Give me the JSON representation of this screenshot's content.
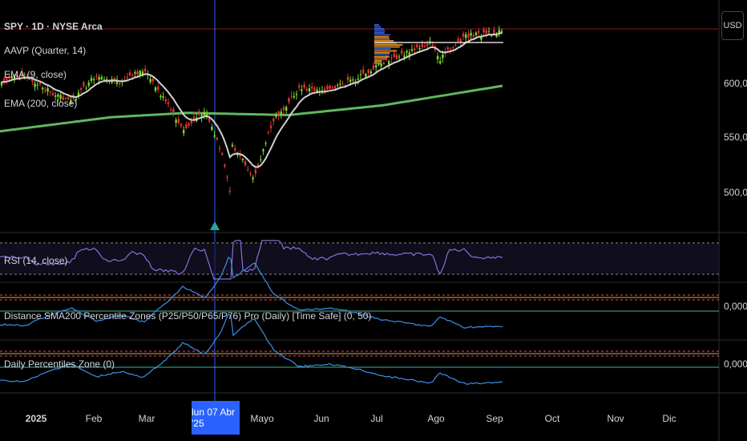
{
  "header": {
    "symbol_line": "SPY · 1D · NYSE Arca",
    "indicators": [
      "AAVP (Quarter, 14)",
      "EMA (9, close)",
      "EMA (200, close)"
    ]
  },
  "currency_button": "USD",
  "cursor_date": "lun 07 Abr '25",
  "colors": {
    "background": "#000000",
    "candle_up": "#7cd82c",
    "candle_down": "#e03434",
    "ema9": "#d0d0d0",
    "ema200": "#5fb85f",
    "rsi": "#8a6fd6",
    "percentile_line": "#3f8ee8",
    "zone_red": "#e05050",
    "zone_orange": "#f0a050",
    "zone_green": "#3cb88a",
    "cursor": "#2962ff"
  },
  "chart_data": [
    {
      "type": "candlestick",
      "title": "SPY · 1D · NYSE Arca",
      "y_ticks": [
        "600,00",
        "550,00",
        "500,00"
      ],
      "ylim": [
        470,
        645
      ],
      "x_ticks": [
        "2025",
        "Feb",
        "Mar",
        "Abr",
        "Mayo",
        "Jun",
        "Jul",
        "Ago",
        "Sep",
        "Oct",
        "Nov",
        "Dic"
      ],
      "overlays": [
        "EMA (9, close)",
        "EMA (200, close)",
        "AAVP (Quarter, 14)"
      ],
      "close_path": [
        {
          "x": "2024-12-02",
          "y": 602
        },
        {
          "x": "2024-12-16",
          "y": 606
        },
        {
          "x": "2024-12-31",
          "y": 590
        },
        {
          "x": "2025-01-10",
          "y": 582
        },
        {
          "x": "2025-01-24",
          "y": 607
        },
        {
          "x": "2025-02-07",
          "y": 600
        },
        {
          "x": "2025-02-19",
          "y": 612
        },
        {
          "x": "2025-03-05",
          "y": 578
        },
        {
          "x": "2025-03-13",
          "y": 555
        },
        {
          "x": "2025-03-25",
          "y": 575
        },
        {
          "x": "2025-04-03",
          "y": 535
        },
        {
          "x": "2025-04-08",
          "y": 497
        },
        {
          "x": "2025-04-09",
          "y": 542
        },
        {
          "x": "2025-04-21",
          "y": 513
        },
        {
          "x": "2025-05-02",
          "y": 566
        },
        {
          "x": "2025-05-16",
          "y": 594
        },
        {
          "x": "2025-06-02",
          "y": 593
        },
        {
          "x": "2025-06-16",
          "y": 603
        },
        {
          "x": "2025-06-30",
          "y": 617
        },
        {
          "x": "2025-07-28",
          "y": 637
        },
        {
          "x": "2025-08-01",
          "y": 621
        },
        {
          "x": "2025-08-15",
          "y": 643
        },
        {
          "x": "2025-09-05",
          "y": 647
        }
      ],
      "ema200_path": [
        {
          "x": "2024-12-02",
          "y": 555
        },
        {
          "x": "2025-02-01",
          "y": 568
        },
        {
          "x": "2025-03-15",
          "y": 572
        },
        {
          "x": "2025-05-10",
          "y": 570
        },
        {
          "x": "2025-07-01",
          "y": 579
        },
        {
          "x": "2025-09-05",
          "y": 597
        }
      ]
    },
    {
      "type": "line",
      "series": [
        {
          "name": "RSI (14, close)",
          "values": []
        }
      ],
      "bands": [
        70,
        30
      ]
    },
    {
      "type": "line",
      "series": [
        {
          "name": "Distance SMA200 Percentile Zones (P25/P50/P65/P76)  Pro (Daily) [Time Safe] (0, 50)",
          "values": []
        }
      ],
      "y_ticks": [
        "0,0000"
      ]
    },
    {
      "type": "line",
      "series": [
        {
          "name": "Daily Percentiles Zone (0)",
          "values": []
        }
      ],
      "y_ticks": [
        "0,0000"
      ]
    }
  ],
  "price_labels": [
    "600,00",
    "550,00",
    "500,00"
  ],
  "pane_labels": {
    "rsi": "RSI (14, close)",
    "distance": "Distance SMA200 Percentile Zones (P25/P50/P65/P76)  Pro (Daily) [Time Safe] (0, 50)",
    "distance_value": "0,0000",
    "daily": "Daily Percentiles Zone (0)",
    "daily_value": "0,0000"
  },
  "x_labels": [
    "2025",
    "Feb",
    "Mar",
    "Mayo",
    "Jun",
    "Jul",
    "Ago",
    "Sep",
    "Oct",
    "Nov",
    "Dic"
  ]
}
